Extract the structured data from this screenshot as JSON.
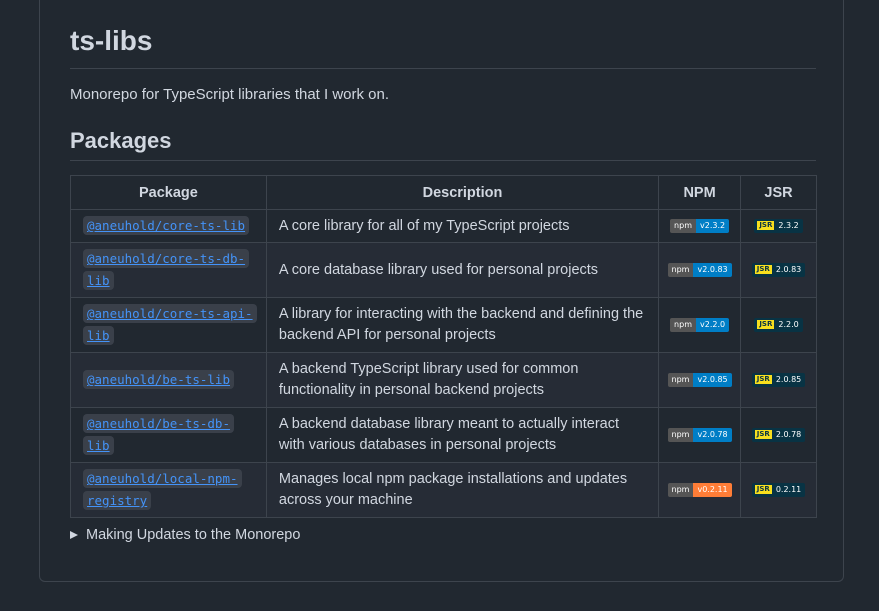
{
  "readme": {
    "title": "ts-libs",
    "intro": "Monorepo for TypeScript libraries that I work on.",
    "packages_heading": "Packages",
    "table": {
      "headers": [
        "Package",
        "Description",
        "NPM",
        "JSR"
      ],
      "rows": [
        {
          "package": "@aneuhold/core-ts-lib",
          "description": "A core library for all of my TypeScript projects",
          "npm_label": "npm",
          "npm_version": "v2.3.2",
          "npm_color": "#007ec6",
          "jsr_logo": "JSR",
          "jsr_version": "2.3.2"
        },
        {
          "package": "@aneuhold/core-ts-db-lib",
          "description": "A core database library used for personal projects",
          "npm_label": "npm",
          "npm_version": "v2.0.83",
          "npm_color": "#007ec6",
          "jsr_logo": "JSR",
          "jsr_version": "2.0.83"
        },
        {
          "package": "@aneuhold/core-ts-api-lib",
          "description": "A library for interacting with the backend and defining the backend API for personal projects",
          "npm_label": "npm",
          "npm_version": "v2.2.0",
          "npm_color": "#007ec6",
          "jsr_logo": "JSR",
          "jsr_version": "2.2.0"
        },
        {
          "package": "@aneuhold/be-ts-lib",
          "description": "A backend TypeScript library used for common functionality in personal backend projects",
          "npm_label": "npm",
          "npm_version": "v2.0.85",
          "npm_color": "#007ec6",
          "jsr_logo": "JSR",
          "jsr_version": "2.0.85"
        },
        {
          "package": "@aneuhold/be-ts-db-lib",
          "description": "A backend database library meant to actually interact with various databases in personal projects",
          "npm_label": "npm",
          "npm_version": "v2.0.78",
          "npm_color": "#007ec6",
          "jsr_logo": "JSR",
          "jsr_version": "2.0.78"
        },
        {
          "package": "@aneuhold/local-npm-registry",
          "description": "Manages local npm package installations and updates across your machine",
          "npm_label": "npm",
          "npm_version": "v0.2.11",
          "npm_color": "#fe7d37",
          "jsr_logo": "JSR",
          "jsr_version": "0.2.11"
        }
      ]
    },
    "details_summary": "Making Updates to the Monorepo"
  }
}
